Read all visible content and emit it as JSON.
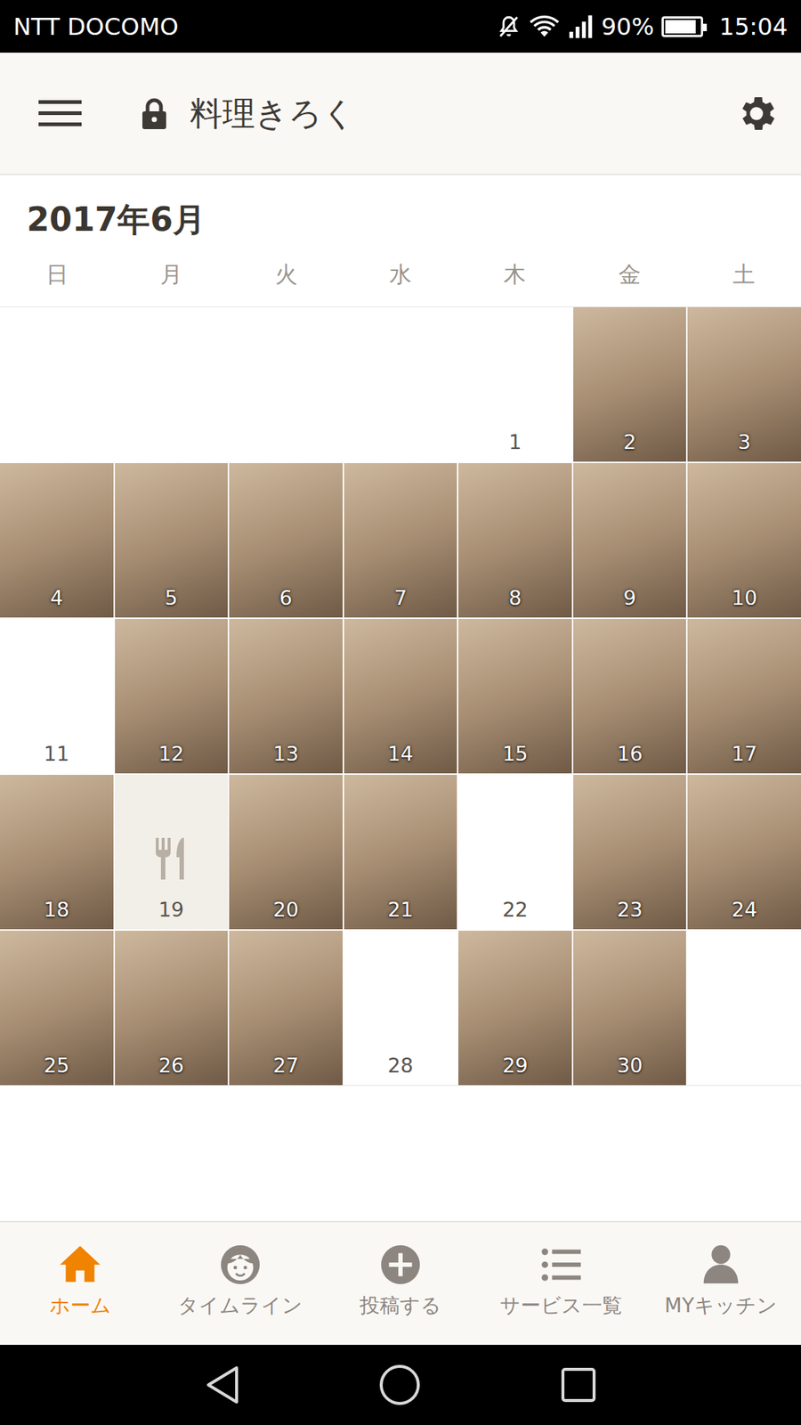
{
  "status_bar": {
    "carrier": "NTT DOCOMO",
    "battery": "90%",
    "battery_level": 0.9,
    "time": "15:04"
  },
  "header": {
    "title": "料理きろく",
    "locked": true
  },
  "calendar": {
    "month": "2017年6月",
    "weekdays": [
      "日",
      "月",
      "火",
      "水",
      "木",
      "金",
      "土"
    ],
    "cells": [
      {
        "kind": "blank"
      },
      {
        "kind": "blank"
      },
      {
        "kind": "blank"
      },
      {
        "kind": "blank"
      },
      {
        "day": "1",
        "kind": "empty"
      },
      {
        "day": "2",
        "kind": "photo"
      },
      {
        "day": "3",
        "kind": "photo"
      },
      {
        "day": "4",
        "kind": "photo"
      },
      {
        "day": "5",
        "kind": "photo"
      },
      {
        "day": "6",
        "kind": "photo"
      },
      {
        "day": "7",
        "kind": "photo"
      },
      {
        "day": "8",
        "kind": "photo"
      },
      {
        "day": "9",
        "kind": "photo"
      },
      {
        "day": "10",
        "kind": "photo"
      },
      {
        "day": "11",
        "kind": "empty"
      },
      {
        "day": "12",
        "kind": "photo"
      },
      {
        "day": "13",
        "kind": "photo"
      },
      {
        "day": "14",
        "kind": "photo"
      },
      {
        "day": "15",
        "kind": "photo"
      },
      {
        "day": "16",
        "kind": "photo"
      },
      {
        "day": "17",
        "kind": "photo"
      },
      {
        "day": "18",
        "kind": "photo"
      },
      {
        "day": "19",
        "kind": "placeholder"
      },
      {
        "day": "20",
        "kind": "photo"
      },
      {
        "day": "21",
        "kind": "photo"
      },
      {
        "day": "22",
        "kind": "empty"
      },
      {
        "day": "23",
        "kind": "photo"
      },
      {
        "day": "24",
        "kind": "photo"
      },
      {
        "day": "25",
        "kind": "photo"
      },
      {
        "day": "26",
        "kind": "photo"
      },
      {
        "day": "27",
        "kind": "photo"
      },
      {
        "day": "28",
        "kind": "empty"
      },
      {
        "day": "29",
        "kind": "photo"
      },
      {
        "day": "30",
        "kind": "photo"
      },
      {
        "kind": "blank"
      }
    ]
  },
  "bottom_nav": {
    "items": [
      {
        "label": "ホーム",
        "selected": true
      },
      {
        "label": "タイムライン",
        "selected": false
      },
      {
        "label": "投稿する",
        "selected": false
      },
      {
        "label": "サービス一覧",
        "selected": false
      },
      {
        "label": "MYキッチン",
        "selected": false
      }
    ]
  }
}
